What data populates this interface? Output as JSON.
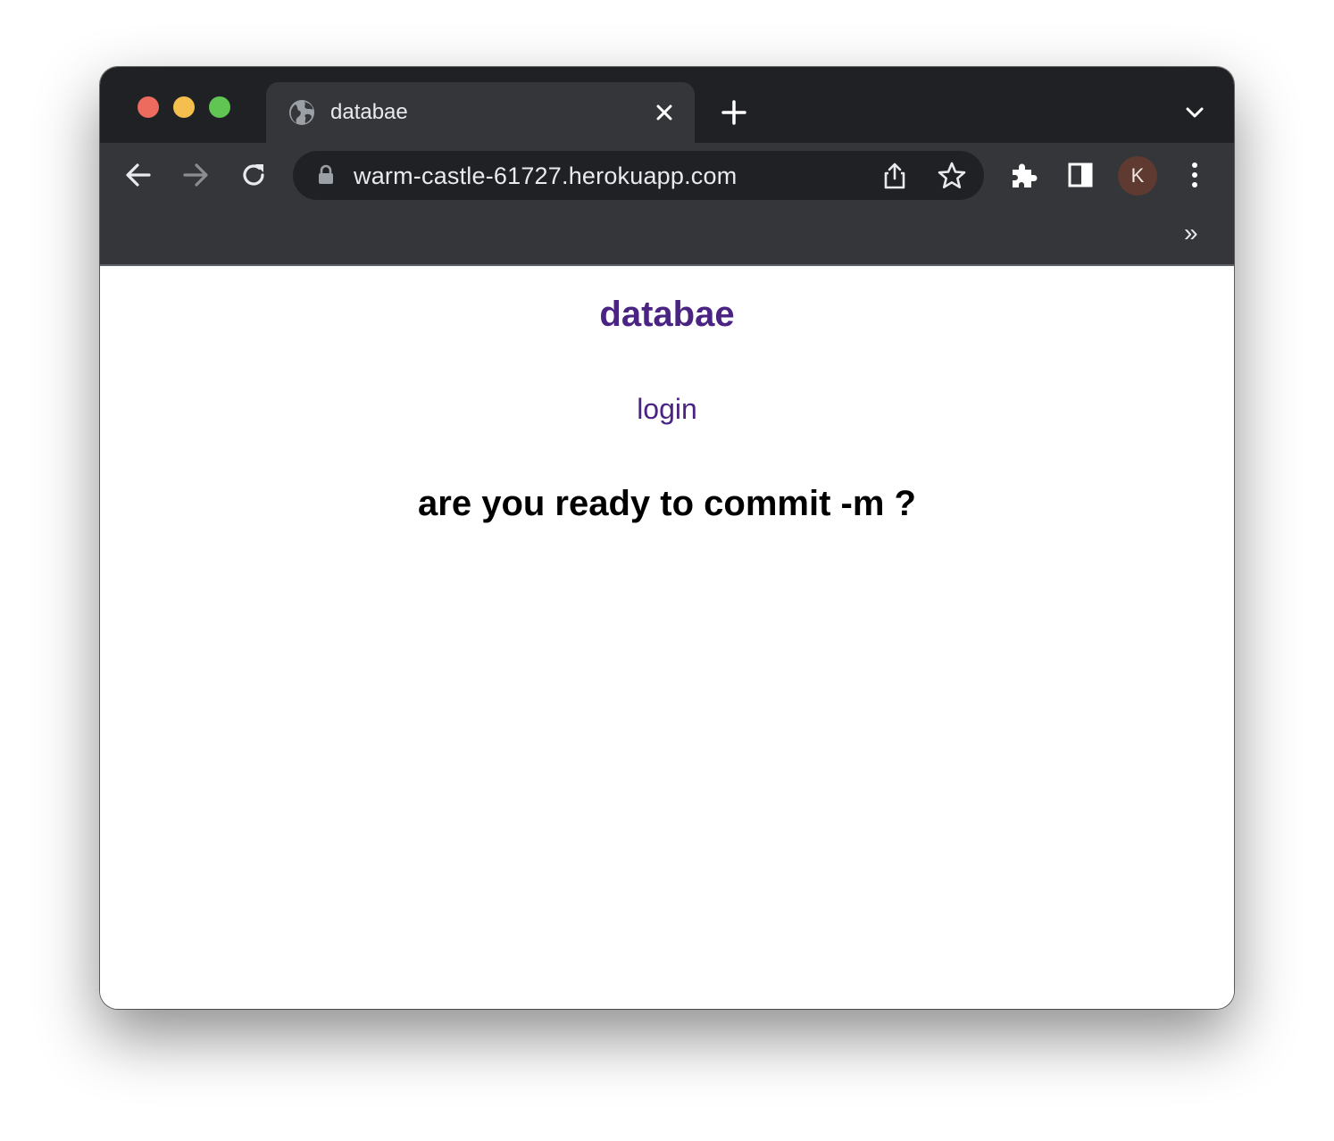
{
  "browser": {
    "tab": {
      "title": "databae"
    },
    "address_bar": {
      "url": "warm-castle-61727.herokuapp.com"
    },
    "profile": {
      "initial": "K"
    },
    "bookmarks": {
      "overflow_label": "»"
    },
    "icons": {
      "favicon": "globe-icon",
      "close_tab": "close-icon",
      "new_tab": "plus-icon",
      "tab_search": "chevron-down-icon",
      "back": "arrow-left-icon",
      "forward": "arrow-right-icon",
      "reload": "reload-icon",
      "lock": "lock-icon",
      "share": "share-icon",
      "bookmark": "star-icon",
      "extensions": "puzzle-icon",
      "side_panel": "side-panel-icon",
      "menu": "kebab-menu-icon"
    }
  },
  "page": {
    "site_title": "databae",
    "login_link": "login",
    "headline": "are you ready to commit -m ?"
  },
  "colors": {
    "brand_purple": "#4b2383",
    "chrome_dark": "#202124",
    "chrome_toolbar": "#35363a",
    "traffic_red": "#ed6a5e",
    "traffic_yellow": "#f5bf4f",
    "traffic_green": "#61c554",
    "avatar_bg": "#5e3a30"
  }
}
